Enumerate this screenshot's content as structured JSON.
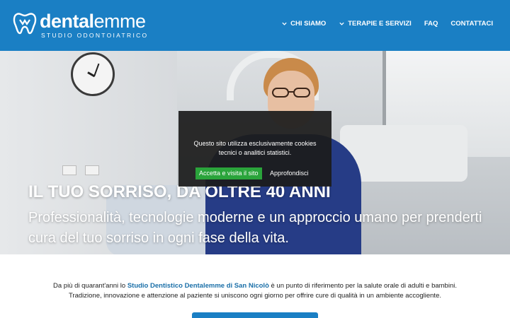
{
  "logo": {
    "brand_bold": "dental",
    "brand_light": "emme",
    "tagline": "STUDIO ODONTOIATRICO"
  },
  "nav": {
    "items": [
      {
        "label": "CHI SIAMO",
        "dropdown": true
      },
      {
        "label": "TERAPIE E SERVIZI",
        "dropdown": true
      },
      {
        "label": "FAQ",
        "dropdown": false
      },
      {
        "label": "CONTATTACI",
        "dropdown": false
      }
    ]
  },
  "hero": {
    "title": "IL TUO SORRISO, DA OLTRE 40 ANNI",
    "subtitle": "Professionalità, tecnologie moderne e un approccio umano per prenderti cura del tuo sorriso in ogni fase della vita."
  },
  "cookie": {
    "message": "Questo sito utilizza esclusivamente cookies tecnici o analitici statistici.",
    "accept_label": "Accetta e visita il sito",
    "more_label": "Approfondisci"
  },
  "intro": {
    "text_before": "Da più di quarant'anni lo ",
    "highlight": "Studio Dentistico Dentalemme di San Nicolò",
    "text_after": " è un punto di riferimento per la salute orale di adulti e bambini.",
    "line2": "Tradizione, innovazione e attenzione al paziente si uniscono ogni giorno per offrire cure di qualità in un ambiente accogliente."
  },
  "colors": {
    "header_bg": "#1a7fc4",
    "accept_button": "#2aa43b",
    "highlight_text": "#1a6fa8"
  },
  "icons": [
    "tooth-logo-icon",
    "chevron-down-icon"
  ]
}
